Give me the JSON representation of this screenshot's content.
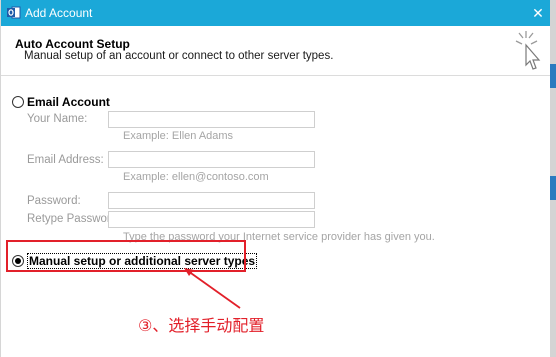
{
  "window": {
    "title": "Add Account",
    "close_glyph": "✕"
  },
  "header": {
    "title": "Auto Account Setup",
    "subtitle": "Manual setup of an account or connect to other server types."
  },
  "email_account": {
    "label": "Email Account",
    "selected": false,
    "fields": {
      "name": {
        "label": "Your Name:",
        "value": "",
        "hint": "Example: Ellen Adams"
      },
      "email": {
        "label": "Email Address:",
        "value": "",
        "hint": "Example: ellen@contoso.com"
      },
      "password": {
        "label": "Password:",
        "value": ""
      },
      "retype_password": {
        "label": "Retype Password:",
        "value": "",
        "hint": "Type the password your Internet service provider has given you."
      }
    }
  },
  "manual_setup": {
    "label": "Manual setup or additional server types",
    "selected": true
  },
  "annotation": {
    "text": "③、选择手动配置",
    "color": "#e2202a"
  },
  "colors": {
    "titlebar": "#1ba8d8",
    "highlight": "#e2202a"
  },
  "icons": {
    "app": "outlook-icon",
    "header": "pointer-cursor-icon",
    "close": "close-icon"
  }
}
